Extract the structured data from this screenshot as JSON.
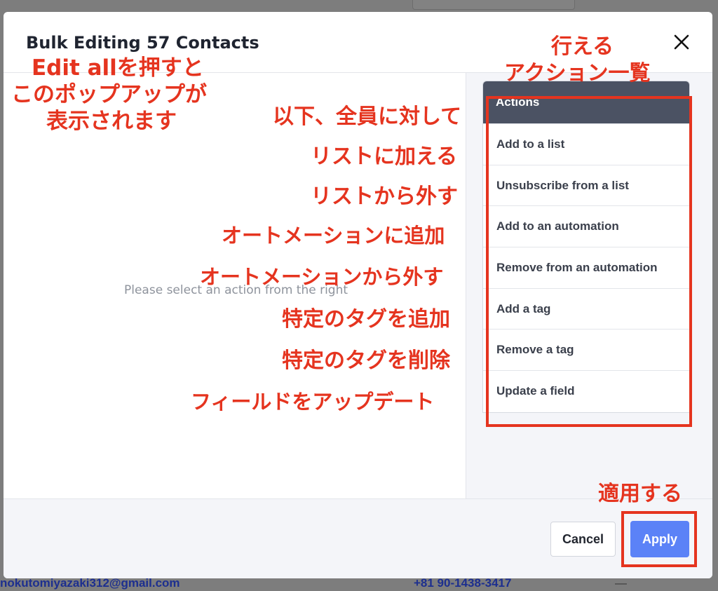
{
  "modal": {
    "title": "Bulk Editing 57 Contacts",
    "placeholder": "Please select an action from the right",
    "actions_header": "Actions",
    "actions": [
      "Add to a list",
      "Unsubscribe from a list",
      "Add to an automation",
      "Remove from an automation",
      "Add a tag",
      "Remove a tag",
      "Update a field"
    ],
    "cancel_label": "Cancel",
    "apply_label": "Apply"
  },
  "background": {
    "email": "nokutomiyazaki312@gmail.com",
    "phone": "+81 90-1438-3417",
    "dash": "—"
  },
  "annotations": {
    "intro_line1": "Edit allを押すと",
    "intro_line2": "このポップアップが",
    "intro_line3": "表示されます",
    "actions_title_line1": "行える",
    "actions_title_line2": "アクション一覧",
    "all_members": "以下、全員に対して",
    "add_list": "リストに加える",
    "remove_list": "リストから外す",
    "add_automation": "オートメーションに追加",
    "remove_automation": "オートメーションから外す",
    "add_tag": "特定のタグを追加",
    "remove_tag": "特定のタグを削除",
    "update_field": "フィールドをアップデート",
    "apply": "適用する"
  },
  "colors": {
    "annotation": "#e5341f",
    "actions_header_bg": "#4b5263",
    "apply_bg": "#5b82f7"
  }
}
